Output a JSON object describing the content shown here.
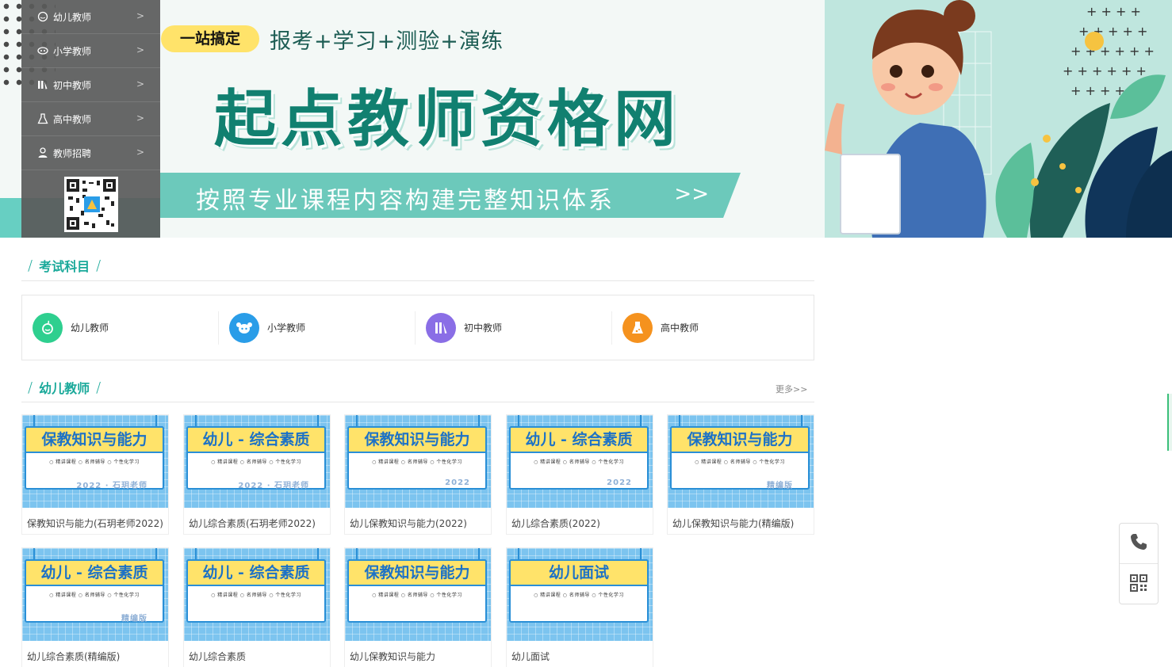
{
  "banner": {
    "tag": "一站搞定",
    "subtitle": "报考+学习+测验+演练",
    "title": "起点教师资格网",
    "bar_text": "按照专业课程内容构建完整知识体系",
    "bar_arrow": ">>"
  },
  "sidenav": {
    "items": [
      {
        "label": "幼儿教师",
        "icon": "baby-icon"
      },
      {
        "label": "小学教师",
        "icon": "child-icon"
      },
      {
        "label": "初中教师",
        "icon": "books-icon"
      },
      {
        "label": "高中教师",
        "icon": "flask-icon"
      },
      {
        "label": "教师招聘",
        "icon": "user-tie-icon"
      }
    ],
    "arrow": ">"
  },
  "exam_section": {
    "title": "考试科目",
    "subjects": [
      {
        "label": "幼儿教师",
        "color": "#2ecf8f"
      },
      {
        "label": "小学教师",
        "color": "#2a9de8"
      },
      {
        "label": "初中教师",
        "color": "#8a6ee6"
      },
      {
        "label": "高中教师",
        "color": "#f5921e"
      }
    ]
  },
  "kid_section": {
    "title": "幼儿教师",
    "more": "更多>>"
  },
  "courses": [
    {
      "cover_title": "保教知识与能力",
      "cover_tags": "○ 精讲课程 ○ 名师辅导 ○ 个性化学习",
      "cover_year": "2022 · 石玥老师",
      "caption": "保教知识与能力(石玥老师2022)"
    },
    {
      "cover_title": "幼儿 - 综合素质",
      "cover_tags": "○ 精讲课程 ○ 名师辅导 ○ 个性化学习",
      "cover_year": "2022 · 石玥老师",
      "caption": "幼儿综合素质(石玥老师2022)"
    },
    {
      "cover_title": "保教知识与能力",
      "cover_tags": "○ 精讲课程 ○ 名师辅导 ○ 个性化学习",
      "cover_year": "2022",
      "caption": "幼儿保教知识与能力(2022)"
    },
    {
      "cover_title": "幼儿 - 综合素质",
      "cover_tags": "○ 精讲课程 ○ 名师辅导 ○ 个性化学习",
      "cover_year": "2022",
      "caption": "幼儿综合素质(2022)"
    },
    {
      "cover_title": "保教知识与能力",
      "cover_tags": "○ 精讲课程 ○ 名师辅导 ○ 个性化学习",
      "cover_year": "精编版",
      "caption": "幼儿保教知识与能力(精编版)"
    },
    {
      "cover_title": "幼儿 - 综合素质",
      "cover_tags": "○ 精讲课程 ○ 名师辅导 ○ 个性化学习",
      "cover_year": "精编版",
      "caption": "幼儿综合素质(精编版)"
    },
    {
      "cover_title": "幼儿 - 综合素质",
      "cover_tags": "○ 精讲课程 ○ 名师辅导 ○ 个性化学习",
      "cover_year": "",
      "caption": "幼儿综合素质"
    },
    {
      "cover_title": "保教知识与能力",
      "cover_tags": "○ 精讲课程 ○ 名师辅导 ○ 个性化学习",
      "cover_year": "",
      "caption": "幼儿保教知识与能力"
    },
    {
      "cover_title": "幼儿面试",
      "cover_tags": "○ 精讲课程 ○ 名师辅导 ○ 个性化学习",
      "cover_year": "",
      "caption": "幼儿面试"
    }
  ],
  "float_tools": {
    "items": [
      {
        "icon": "phone-icon"
      },
      {
        "icon": "qrcode-icon"
      }
    ]
  },
  "colors": {
    "accent": "#1aa99a",
    "sidenav_bg": "#5a5a5a",
    "card_blue": "#7cc4ef"
  }
}
